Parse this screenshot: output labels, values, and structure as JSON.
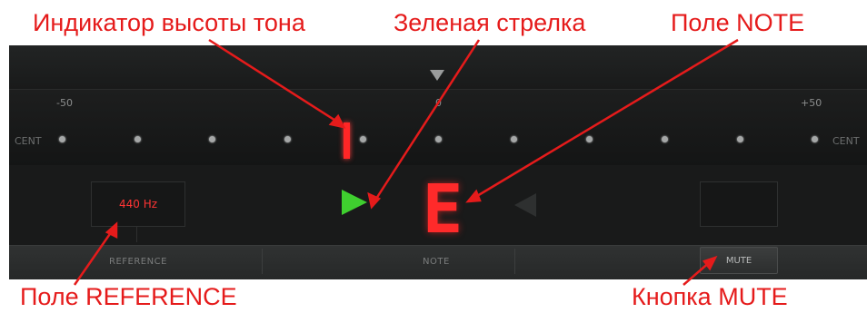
{
  "callouts": {
    "pitch_indicator": "Индикатор высоты тона",
    "green_arrow": "Зеленая стрелка",
    "note_field": "Поле NOTE",
    "reference_field": "Поле REFERENCE",
    "mute_button": "Кнопка MUTE"
  },
  "scale": {
    "min_label": "-50",
    "center_label": "0",
    "max_label": "+50",
    "unit_left": "CENT",
    "unit_right": "CENT"
  },
  "reference": {
    "value": "440 Hz",
    "label": "REFERENCE"
  },
  "note": {
    "value": "E",
    "label": "NOTE"
  },
  "mute": {
    "label": "MUTE"
  },
  "colors": {
    "callout_red": "#e51b1b",
    "display_red": "#ff2a2a",
    "arrow_green": "#3fcf2f",
    "panel_dark": "#1a1b1b"
  },
  "icons": {
    "top_marker": "triangle-down-icon",
    "green_arrow": "arrow-right-icon",
    "dim_arrow": "arrow-left-icon"
  }
}
